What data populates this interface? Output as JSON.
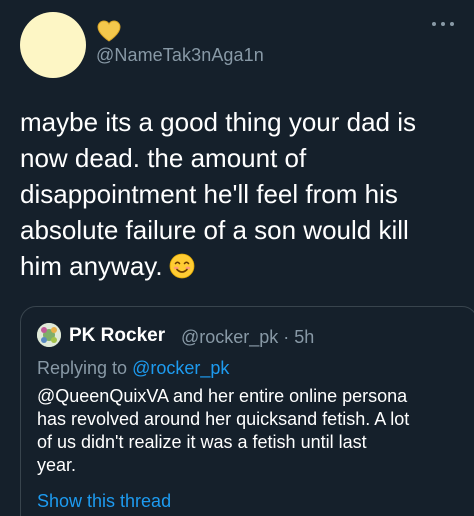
{
  "tweet": {
    "handle": "@NameTak3nAga1n",
    "text_lines": [
      "maybe its a good thing your dad is",
      "now dead. the amount of",
      "disappointment he'll feel from his",
      "absolute failure of a son would kill",
      "him anyway."
    ],
    "emoji": "smiling-face-icon",
    "heart_icon": "yellow-heart-icon",
    "avatar_color": "#fdf6c5"
  },
  "quote": {
    "display_name": "PK Rocker",
    "meta": "@rocker_pk · 5h",
    "replying_prefix": "Replying to ",
    "replying_mention": "@rocker_pk",
    "text_lines": [
      "@QueenQuixVA and her entire online persona",
      "has revolved around her quicksand fetish. A lot",
      "of us didn't realize it was a fetish until last",
      "year."
    ],
    "show_thread": "Show this thread"
  },
  "colors": {
    "background": "#15202b",
    "secondary_text": "#8899a6",
    "link": "#1d9bf0",
    "border": "#38444d"
  }
}
